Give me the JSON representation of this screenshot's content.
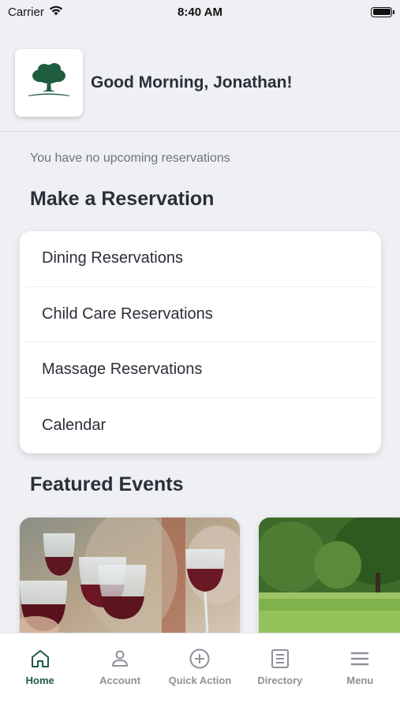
{
  "status_bar": {
    "carrier": "Carrier",
    "time": "8:40 AM",
    "icons": [
      "wifi-icon",
      "battery-icon"
    ]
  },
  "header": {
    "logo_icon": "oak-tree-logo-icon",
    "greeting": "Good Morning, Jonathan!"
  },
  "reservations": {
    "empty_message": "You have no upcoming reservations",
    "section_title": "Make a Reservation",
    "items": [
      {
        "label": "Dining Reservations"
      },
      {
        "label": "Child Care Reservations"
      },
      {
        "label": "Massage Reservations"
      },
      {
        "label": "Calendar"
      }
    ]
  },
  "featured": {
    "section_title": "Featured Events",
    "events": [
      {
        "image": "wine-glasses-toast-photo"
      },
      {
        "image": "golf-course-tree-photo"
      }
    ]
  },
  "tab_bar": {
    "tabs": [
      {
        "label": "Home",
        "icon": "home-icon",
        "active": true
      },
      {
        "label": "Account",
        "icon": "person-icon",
        "active": false
      },
      {
        "label": "Quick Action",
        "icon": "plus-circle-icon",
        "active": false
      },
      {
        "label": "Directory",
        "icon": "list-icon",
        "active": false
      },
      {
        "label": "Menu",
        "icon": "hamburger-icon",
        "active": false
      }
    ]
  },
  "colors": {
    "brand": "#1f5c3f",
    "background": "#eef0f4",
    "inactive_tab": "#8d9199",
    "text": "#2b2f38"
  }
}
